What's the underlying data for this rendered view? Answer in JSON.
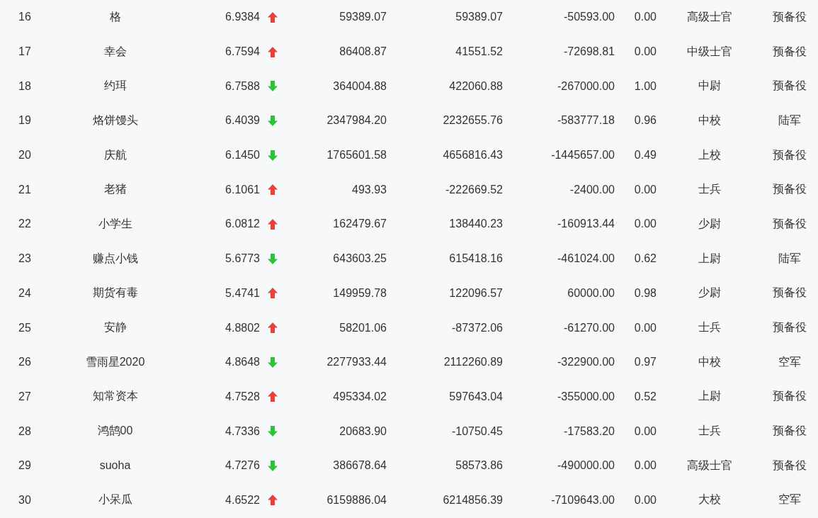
{
  "table": {
    "rows": [
      {
        "no": "16",
        "name": "格",
        "score": "6.9384",
        "rising": true,
        "value_1": "59389.07",
        "value_2": "59389.07",
        "value_3": "-50593.00",
        "ratio": "0.00",
        "rank_title": "高级士官",
        "branch": "预备役"
      },
      {
        "no": "17",
        "name": "幸会",
        "score": "6.7594",
        "rising": true,
        "value_1": "86408.87",
        "value_2": "41551.52",
        "value_3": "-72698.81",
        "ratio": "0.00",
        "rank_title": "中级士官",
        "branch": "预备役"
      },
      {
        "no": "18",
        "name": "约珥",
        "score": "6.7588",
        "rising": false,
        "value_1": "364004.88",
        "value_2": "422060.88",
        "value_3": "-267000.00",
        "ratio": "1.00",
        "rank_title": "中尉",
        "branch": "预备役"
      },
      {
        "no": "19",
        "name": "烙饼馒头",
        "score": "6.4039",
        "rising": false,
        "value_1": "2347984.20",
        "value_2": "2232655.76",
        "value_3": "-583777.18",
        "ratio": "0.96",
        "rank_title": "中校",
        "branch": "陆军"
      },
      {
        "no": "20",
        "name": "庆航",
        "score": "6.1450",
        "rising": false,
        "value_1": "1765601.58",
        "value_2": "4656816.43",
        "value_3": "-1445657.00",
        "ratio": "0.49",
        "rank_title": "上校",
        "branch": "预备役"
      },
      {
        "no": "21",
        "name": "老猪",
        "score": "6.1061",
        "rising": true,
        "value_1": "493.93",
        "value_2": "-222669.52",
        "value_3": "-2400.00",
        "ratio": "0.00",
        "rank_title": "士兵",
        "branch": "预备役"
      },
      {
        "no": "22",
        "name": "小学生",
        "score": "6.0812",
        "rising": true,
        "value_1": "162479.67",
        "value_2": "138440.23",
        "value_3": "-160913.44",
        "ratio": "0.00",
        "rank_title": "少尉",
        "branch": "预备役"
      },
      {
        "no": "23",
        "name": "赚点小钱",
        "score": "5.6773",
        "rising": false,
        "value_1": "643603.25",
        "value_2": "615418.16",
        "value_3": "-461024.00",
        "ratio": "0.62",
        "rank_title": "上尉",
        "branch": "陆军"
      },
      {
        "no": "24",
        "name": "期货有毒",
        "score": "5.4741",
        "rising": true,
        "value_1": "149959.78",
        "value_2": "122096.57",
        "value_3": "60000.00",
        "ratio": "0.98",
        "rank_title": "少尉",
        "branch": "预备役"
      },
      {
        "no": "25",
        "name": "安静",
        "score": "4.8802",
        "rising": true,
        "value_1": "58201.06",
        "value_2": "-87372.06",
        "value_3": "-61270.00",
        "ratio": "0.00",
        "rank_title": "士兵",
        "branch": "预备役"
      },
      {
        "no": "26",
        "name": "雪雨星2020",
        "score": "4.8648",
        "rising": false,
        "value_1": "2277933.44",
        "value_2": "2112260.89",
        "value_3": "-322900.00",
        "ratio": "0.97",
        "rank_title": "中校",
        "branch": "空军"
      },
      {
        "no": "27",
        "name": "知常资本",
        "score": "4.7528",
        "rising": true,
        "value_1": "495334.02",
        "value_2": "597643.04",
        "value_3": "-355000.00",
        "ratio": "0.52",
        "rank_title": "上尉",
        "branch": "预备役"
      },
      {
        "no": "28",
        "name": "鸿鹄00",
        "score": "4.7336",
        "rising": false,
        "value_1": "20683.90",
        "value_2": "-10750.45",
        "value_3": "-17583.20",
        "ratio": "0.00",
        "rank_title": "士兵",
        "branch": "预备役"
      },
      {
        "no": "29",
        "name": "suoha",
        "score": "4.7276",
        "rising": false,
        "value_1": "386678.64",
        "value_2": "58573.86",
        "value_3": "-490000.00",
        "ratio": "0.00",
        "rank_title": "高级士官",
        "branch": "预备役"
      },
      {
        "no": "30",
        "name": "小呆瓜",
        "score": "4.6522",
        "rising": true,
        "value_1": "6159886.04",
        "value_2": "6214856.39",
        "value_3": "-7109643.00",
        "ratio": "0.00",
        "rank_title": "大校",
        "branch": "空军"
      }
    ]
  }
}
